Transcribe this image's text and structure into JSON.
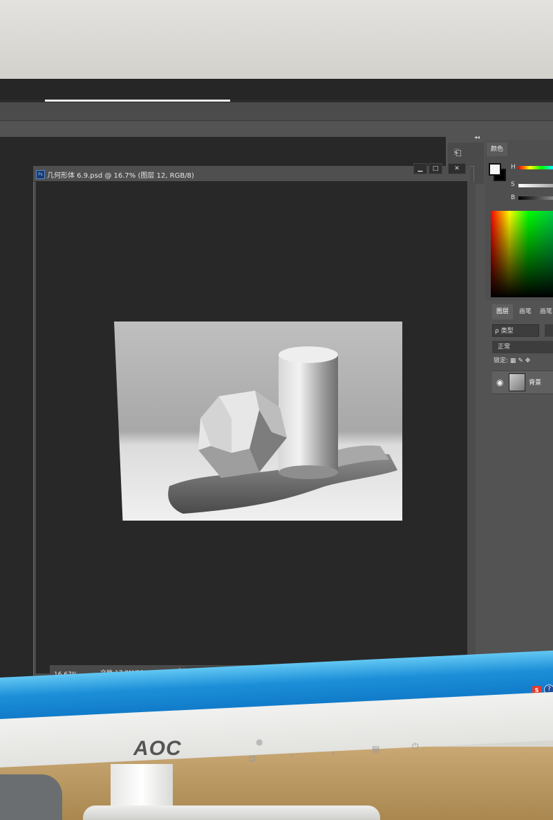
{
  "monitor": {
    "brand": "AOC"
  },
  "document": {
    "title": "几何形体   6.9.psd @ 16.7% (图层 12, RGB/8)",
    "app_icon_label": "Ps",
    "zoom_level": "16.67%",
    "doc_size": "文档:17.2M/254.8M",
    "status_arrow": "›"
  },
  "panels": {
    "color": {
      "tab_label": "颜色",
      "slider_labels": [
        "H",
        "S",
        "B"
      ]
    },
    "layers": {
      "tabs": [
        "图层",
        "画笔",
        "画笔"
      ],
      "kind_filter": "ρ 类型",
      "blend_mode": "正常",
      "lock_label": "锁定:",
      "layer": {
        "name": "背景"
      }
    }
  },
  "window_buttons": {
    "minimize": "▁",
    "maximize": "□",
    "close": "✕"
  },
  "tray": {
    "icon1": "S",
    "icon2": "?"
  },
  "icons": {
    "eye": "eye-icon",
    "filter": "filter-icon",
    "tool": "tool-icon"
  },
  "colors": {
    "ps_dark": "#282828",
    "taskbar_blue": "#1c8fd8"
  }
}
